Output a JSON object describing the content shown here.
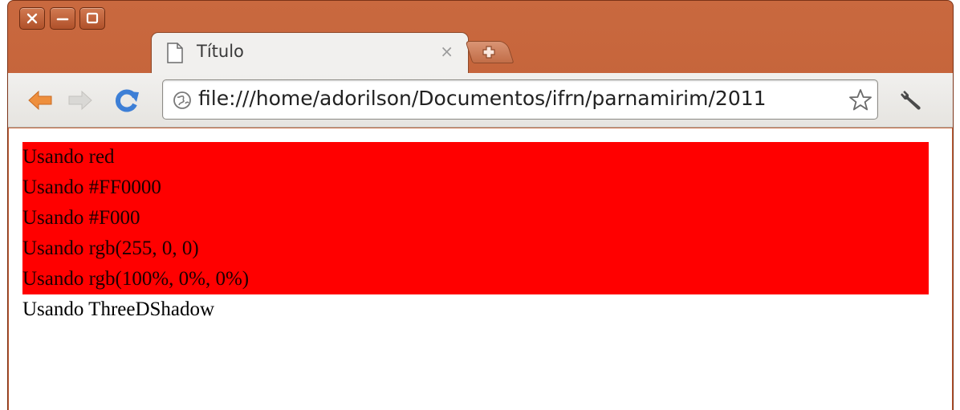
{
  "window": {
    "controls": [
      "close-icon",
      "minimize-icon",
      "maximize-icon"
    ]
  },
  "tab": {
    "title": "Título",
    "close_glyph": "×",
    "favicon": "page-icon"
  },
  "new_tab": {
    "icon": "plus-icon"
  },
  "toolbar": {
    "back_icon": "back-arrow-icon",
    "forward_icon": "forward-arrow-icon",
    "reload_icon": "reload-icon",
    "url": "file:///home/adorilson/Documentos/ifrn/parnamirim/2011",
    "bookmark_icon": "star-icon",
    "menu_icon": "wrench-icon"
  },
  "content": {
    "red_lines": [
      "Usando red",
      "Usando #FF0000",
      "Usando #F000",
      "Usando rgb(255, 0, 0)",
      "Usando rgb(100%, 0%, 0%)"
    ],
    "plain_line": "Usando ThreeDShadow"
  },
  "colors": {
    "frame": "#c0603a",
    "red_background": "#ff0000",
    "back_arrow": "#e8883a",
    "reload": "#3d7fd6"
  }
}
